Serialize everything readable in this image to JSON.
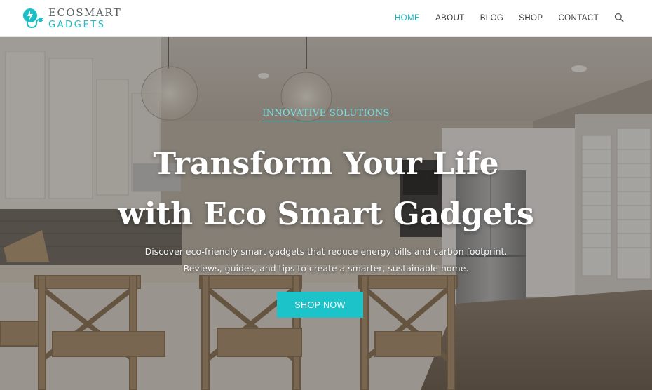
{
  "brand": {
    "name_line1": "ECOSMART",
    "name_line2": "GADGETS",
    "accent_color": "#1bbfc4",
    "icon": "lightbulb-plug-logo-icon"
  },
  "nav": {
    "items": [
      {
        "label": "HOME",
        "active": true
      },
      {
        "label": "ABOUT",
        "active": false
      },
      {
        "label": "BLOG",
        "active": false
      },
      {
        "label": "SHOP",
        "active": false
      },
      {
        "label": "CONTACT",
        "active": false
      }
    ],
    "search_icon": "search-icon",
    "active_color": "#19b5bd"
  },
  "hero": {
    "eyebrow": "INNOVATIVE SOLUTIONS",
    "headline_line1": "Transform Your Life",
    "headline_line2": "with Eco Smart Gadgets",
    "subtext_line1": "Discover eco-friendly smart gadgets that reduce energy bills and carbon footprint.",
    "subtext_line2": "Reviews, guides, and tips to create a smarter, sustainable home.",
    "cta_label": "SHOP NOW",
    "cta_color": "#1cc3c8"
  }
}
